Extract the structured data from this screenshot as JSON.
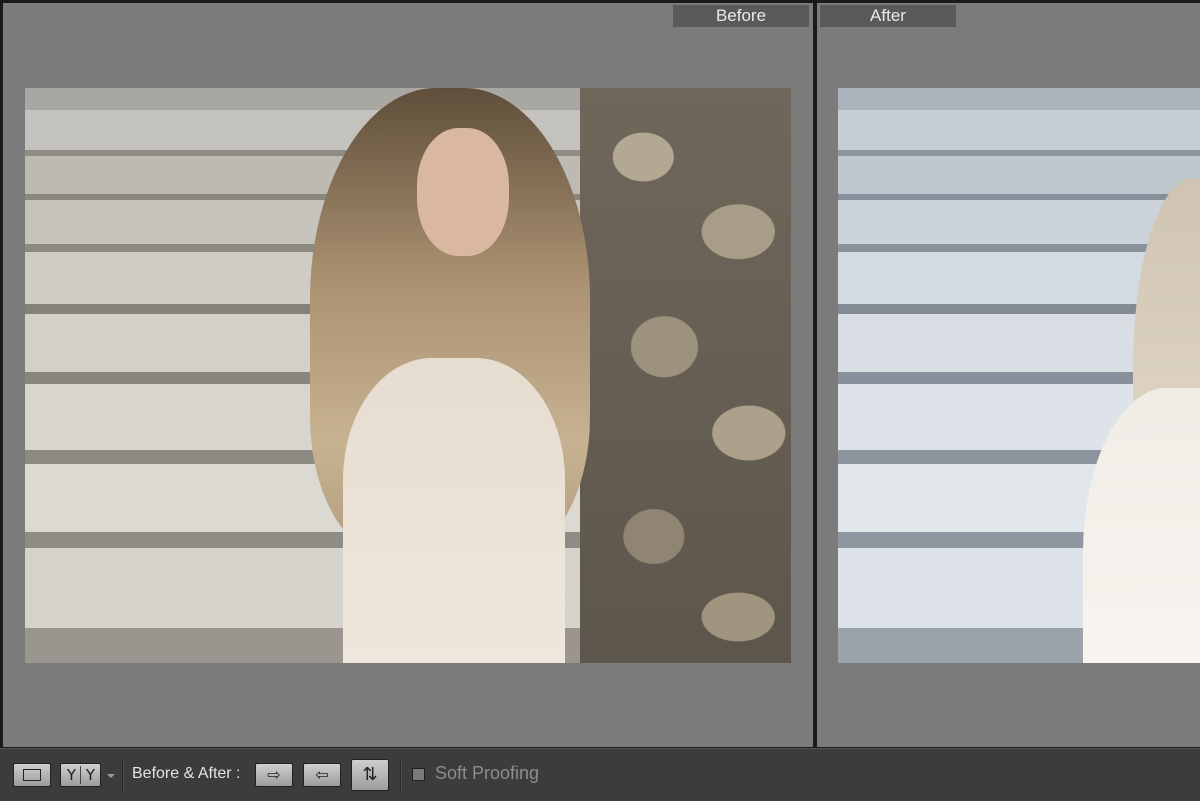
{
  "panes": {
    "before": {
      "label": "Before"
    },
    "after": {
      "label": "After"
    }
  },
  "toolbar": {
    "loupe_view_icon": "rectangle-icon",
    "before_after_mode": {
      "left": "Y",
      "right": "Y"
    },
    "before_after_label": "Before & After :",
    "copy_before_to_after_icon": "arrow-right-icon",
    "copy_after_to_before_icon": "arrow-left-icon",
    "swap_icon": "swap-vertical-icon",
    "soft_proofing_label": "Soft Proofing",
    "soft_proofing_checked": false
  },
  "colors": {
    "pane_background": "#7b7b7b",
    "label_background": "#5a5a5a",
    "toolbar_background": "#3c3c3c",
    "divider": "#1a1a1a"
  }
}
